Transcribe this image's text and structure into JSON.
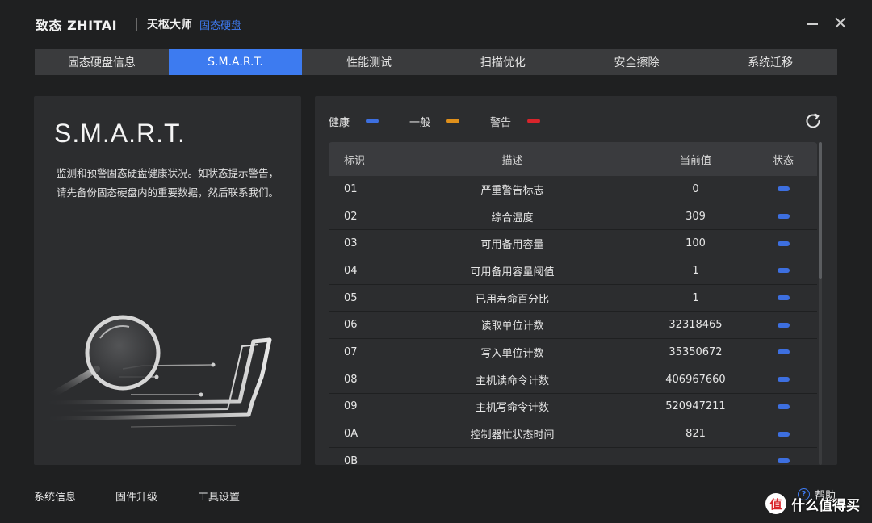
{
  "titlebar": {
    "brand": "致态 ZHITAI",
    "product": "天枢大师",
    "product_sub": "固态硬盘"
  },
  "tabs": [
    {
      "label": "固态硬盘信息",
      "active": false
    },
    {
      "label": "S.M.A.R.T.",
      "active": true
    },
    {
      "label": "性能测试",
      "active": false
    },
    {
      "label": "扫描优化",
      "active": false
    },
    {
      "label": "安全擦除",
      "active": false
    },
    {
      "label": "系统迁移",
      "active": false
    }
  ],
  "left": {
    "title": "S.M.A.R.T.",
    "description": "监测和预警固态硬盘健康状况。如状态提示警告，请先备份固态硬盘内的重要数据，然后联系我们。"
  },
  "legend": [
    {
      "label": "健康",
      "color": "#3d6fe0"
    },
    {
      "label": "一般",
      "color": "#e0901b"
    },
    {
      "label": "警告",
      "color": "#d9242b"
    }
  ],
  "table": {
    "headers": {
      "id": "标识",
      "desc": "描述",
      "value": "当前值",
      "state": "状态"
    },
    "rows": [
      {
        "id": "01",
        "desc": "严重警告标志",
        "value": "0",
        "state": "健康"
      },
      {
        "id": "02",
        "desc": "综合温度",
        "value": "309",
        "state": "健康"
      },
      {
        "id": "03",
        "desc": "可用备用容量",
        "value": "100",
        "state": "健康"
      },
      {
        "id": "04",
        "desc": "可用备用容量阈值",
        "value": "1",
        "state": "健康"
      },
      {
        "id": "05",
        "desc": "已用寿命百分比",
        "value": "1",
        "state": "健康"
      },
      {
        "id": "06",
        "desc": "读取单位计数",
        "value": "32318465",
        "state": "健康"
      },
      {
        "id": "07",
        "desc": "写入单位计数",
        "value": "35350672",
        "state": "健康"
      },
      {
        "id": "08",
        "desc": "主机读命令计数",
        "value": "406967660",
        "state": "健康"
      },
      {
        "id": "09",
        "desc": "主机写命令计数",
        "value": "520947211",
        "state": "健康"
      },
      {
        "id": "0A",
        "desc": "控制器忙状态时间",
        "value": "821",
        "state": "健康"
      },
      {
        "id": "0B",
        "desc": "",
        "value": "",
        "state": "健康"
      }
    ]
  },
  "footer": {
    "system_info": "系统信息",
    "firmware": "固件升级",
    "tools": "工具设置",
    "help": "帮助",
    "help_glyph": "?"
  },
  "watermark": {
    "badge": "值",
    "text": "什么值得买"
  },
  "icons": {
    "refresh": "refresh-icon",
    "help": "help-icon",
    "minimize": "minimize-icon",
    "close": "close-icon"
  }
}
